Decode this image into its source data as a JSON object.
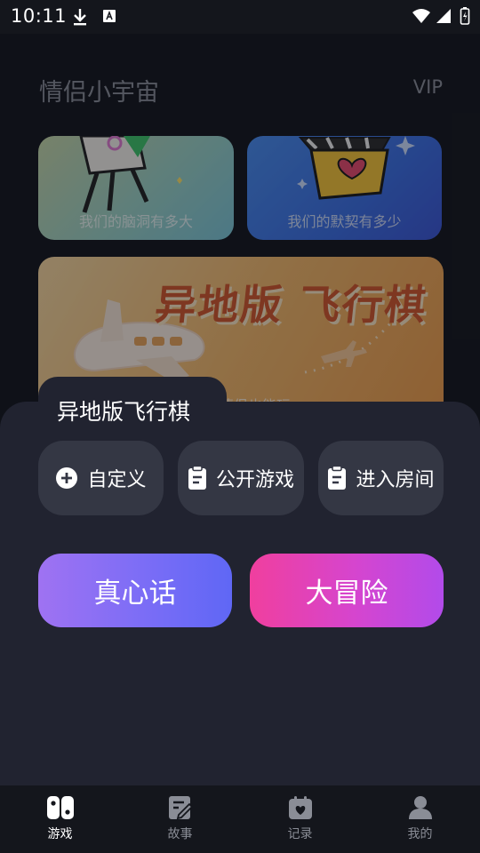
{
  "status_bar": {
    "time": "10:11"
  },
  "header": {
    "title": "情侣小宇宙",
    "vip": "VIP"
  },
  "cards": [
    {
      "caption": "我们的脑洞有多大"
    },
    {
      "caption": "我们的默契有多少"
    },
    {
      "banner_title": "异地版 飞行棋",
      "caption": "异地情侣也能玩"
    }
  ],
  "sheet": {
    "title": "异地版飞行棋",
    "options": [
      {
        "label": "自定义",
        "icon": "plus-circle-icon"
      },
      {
        "label": "公开游戏",
        "icon": "clipboard-icon"
      },
      {
        "label": "进入房间",
        "icon": "clipboard-icon"
      }
    ],
    "buttons": {
      "truth": "真心话",
      "dare": "大冒险"
    }
  },
  "nav": [
    {
      "label": "游戏",
      "active": true
    },
    {
      "label": "故事",
      "active": false
    },
    {
      "label": "记录",
      "active": false
    },
    {
      "label": "我的",
      "active": false
    }
  ],
  "colors": {
    "background": "#14161c",
    "sheet": "#212330",
    "option": "#343744",
    "truth_gradient": [
      "#9f72f2",
      "#5f67f5"
    ],
    "dare_gradient": [
      "#f03f9e",
      "#b24bea"
    ]
  }
}
